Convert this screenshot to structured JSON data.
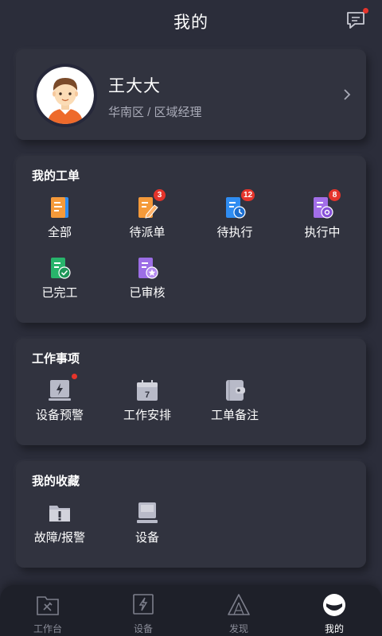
{
  "header": {
    "title": "我的",
    "message_icon": "message-icon"
  },
  "profile": {
    "name": "王大大",
    "role": "华南区 / 区域经理",
    "avatar_icon": "avatar-man-icon"
  },
  "work_orders": {
    "title": "我的工单",
    "items": [
      {
        "label": "全部",
        "icon": "all-orders-icon",
        "color": "#f59a3a",
        "badge": ""
      },
      {
        "label": "待派单",
        "icon": "pending-dispatch-icon",
        "color": "#f59a3a",
        "badge": "3"
      },
      {
        "label": "待执行",
        "icon": "pending-execute-icon",
        "color": "#2f8df2",
        "badge": "12"
      },
      {
        "label": "执行中",
        "icon": "executing-icon",
        "color": "#a26ee8",
        "badge": "8"
      },
      {
        "label": "已完工",
        "icon": "completed-icon",
        "color": "#28b46b",
        "badge": ""
      },
      {
        "label": "已审核",
        "icon": "reviewed-icon",
        "color": "#9c6ee6",
        "badge": ""
      }
    ]
  },
  "affairs": {
    "title": "工作事项",
    "items": [
      {
        "label": "设备预警",
        "icon": "device-alert-icon"
      },
      {
        "label": "工作安排",
        "icon": "calendar-icon",
        "calendar_day": "7"
      },
      {
        "label": "工单备注",
        "icon": "note-wallet-icon"
      }
    ]
  },
  "favorites": {
    "title": "我的收藏",
    "items": [
      {
        "label": "故障/报警",
        "icon": "fault-folder-icon"
      },
      {
        "label": "设备",
        "icon": "device-icon"
      }
    ]
  },
  "tabbar": {
    "items": [
      {
        "label": "工作台",
        "icon": "workbench-icon"
      },
      {
        "label": "设备",
        "icon": "device-tab-icon"
      },
      {
        "label": "发现",
        "icon": "discover-icon"
      },
      {
        "label": "我的",
        "icon": "profile-tab-icon"
      }
    ],
    "active": "我的"
  },
  "colors": {
    "background": "#2b2d3a",
    "card": "#31333f",
    "badge": "#e5342b",
    "tabbar": "#1e2029"
  }
}
